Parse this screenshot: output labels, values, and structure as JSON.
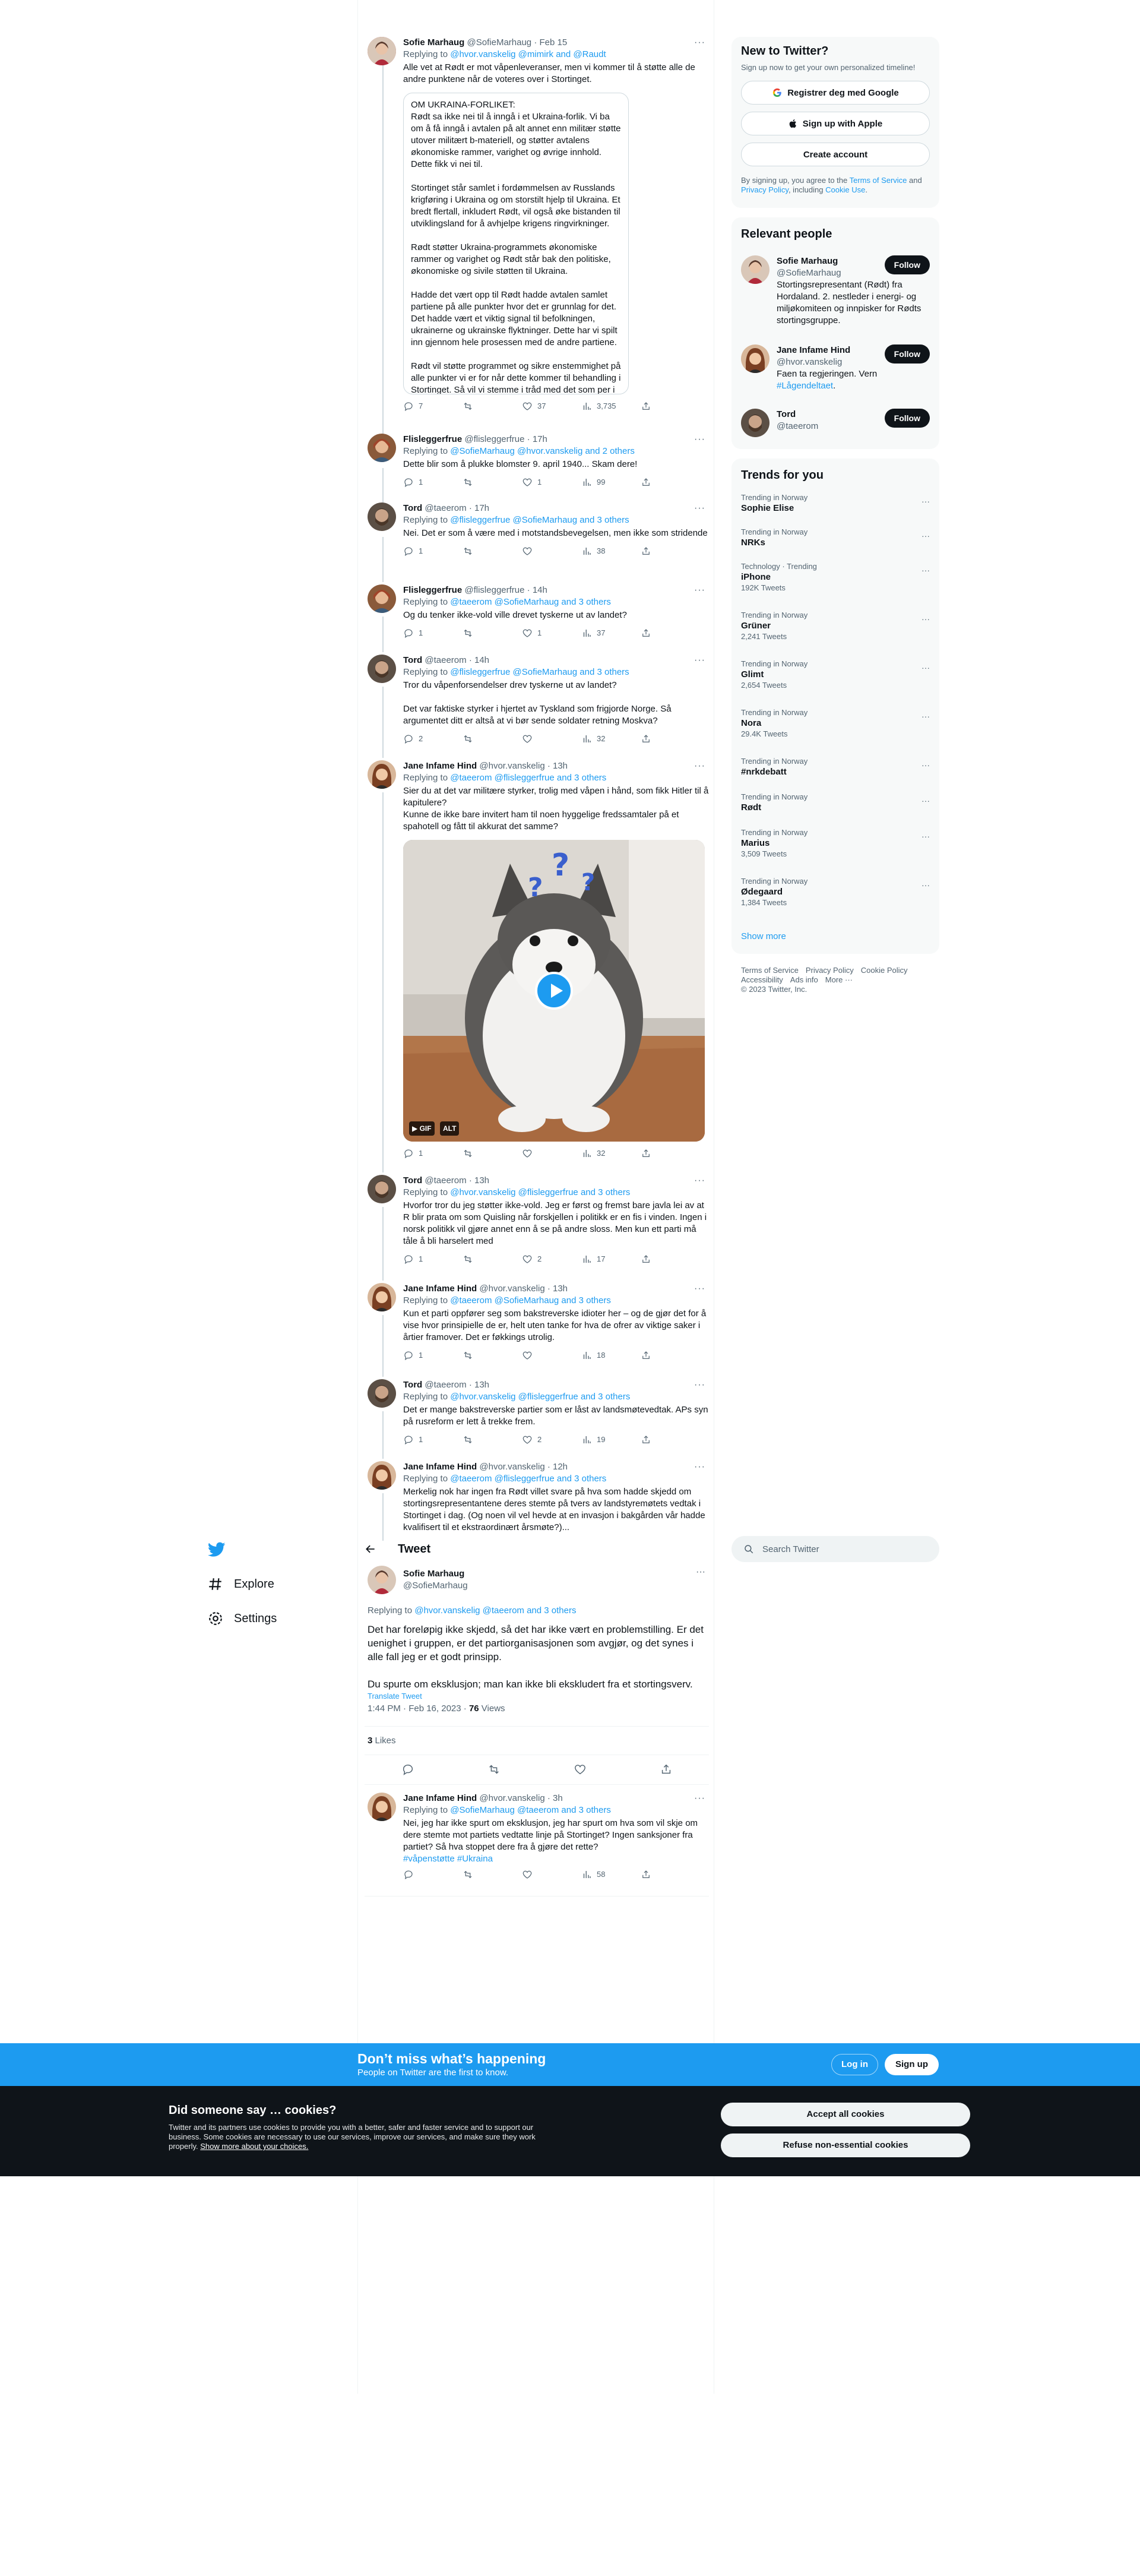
{
  "nav": {
    "explore": "Explore",
    "settings": "Settings"
  },
  "search": {
    "placeholder": "Search Twitter"
  },
  "signup": {
    "title": "New to Twitter?",
    "subtitle": "Sign up now to get your own personalized timeline!",
    "google": "Registrer deg med Google",
    "apple": "Sign up with Apple",
    "create": "Create account",
    "legal_pre": "By signing up, you agree to the ",
    "tos": "Terms of Service",
    "legal_mid": " and ",
    "privacy": "Privacy Policy",
    "legal_mid2": ", including ",
    "cookie": "Cookie Use",
    "legal_end": "."
  },
  "relevant": {
    "title": "Relevant people",
    "people": [
      {
        "name": "Sofie Marhaug",
        "handle": "@SofieMarhaug",
        "bio": "Stortingsrepresentant (Rødt) fra Hordaland. 2. nestleder i energi- og miljøkomiteen og innpisker for Rødts stortingsgruppe.",
        "follow": "Follow"
      },
      {
        "name": "Jane Infame Hind",
        "handle": "@hvor.vanskelig",
        "bio": "Faen ta regjeringen. Vern ",
        "bio_tag": "#Lågendeltaet",
        "bio_end": ".",
        "follow": "Follow"
      },
      {
        "name": "Tord",
        "handle": "@taeerom",
        "bio": "",
        "follow": "Follow"
      }
    ]
  },
  "trends": {
    "title": "Trends for you",
    "items": [
      {
        "meta": "Trending in Norway",
        "title": "Sophie Elise",
        "count": ""
      },
      {
        "meta": "Trending in Norway",
        "title": "NRKs",
        "count": ""
      },
      {
        "meta": "Technology · Trending",
        "title": "iPhone",
        "count": "192K Tweets"
      },
      {
        "meta": "Trending in Norway",
        "title": "Grüner",
        "count": "2,241 Tweets"
      },
      {
        "meta": "Trending in Norway",
        "title": "Glimt",
        "count": "2,654 Tweets"
      },
      {
        "meta": "Trending in Norway",
        "title": "Nora",
        "count": "29.4K Tweets"
      },
      {
        "meta": "Trending in Norway",
        "title": "#nrkdebatt",
        "count": ""
      },
      {
        "meta": "Trending in Norway",
        "title": "Rødt",
        "count": ""
      },
      {
        "meta": "Trending in Norway",
        "title": "Marius",
        "count": "3,509 Tweets"
      },
      {
        "meta": "Trending in Norway",
        "title": "Ødegaard",
        "count": "1,384 Tweets"
      }
    ],
    "show_more": "Show more"
  },
  "footer": {
    "links1": [
      "Terms of Service",
      "Privacy Policy",
      "Cookie Policy"
    ],
    "links2": [
      "Accessibility",
      "Ads info",
      "More ···"
    ],
    "copyright": "© 2023 Twitter, Inc."
  },
  "tweets": [
    {
      "name": "Sofie Marhaug",
      "handle": "@SofieMarhaug",
      "time": "Feb 15",
      "reply_pre": "Replying to ",
      "reply_to": "@hvor.vanskelig @mimirk and @Raudt",
      "text": "Alle vet at Rødt er mot våpenleveranser, men vi kommer til å støtte alle de andre punktene når de voteres over i Stortinget.",
      "quote": "OM UKRAINA-FORLIKET:\nRødt sa ikke nei til å inngå i et Ukraina-forlik. Vi ba om å få inngå i avtalen på alt annet enn militær støtte utover militært b-materiell, og støtter avtalens økonomiske rammer, varighet og øvrige innhold. Dette fikk vi nei til.\n\nStortinget står samlet i fordømmelsen av Russlands krigføring i Ukraina og om storstilt hjelp til Ukraina. Et bredt flertall, inkludert Rødt, vil også øke bistanden til utviklingsland for å avhjelpe krigens ringvirkninger.\n\nRødt støtter Ukraina-programmets økonomiske rammer og varighet og Rødt står bak den politiske, økonomiske og sivile støtten til Ukraina.\n\nHadde det vært opp til Rødt hadde avtalen samlet partiene på alle punkter hvor det er grunnlag for det. Det hadde vært et viktig signal til befolkningen, ukrainerne og ukrainske flyktninger. Dette har vi spilt inn gjennom hele prosessen med de andre partiene.\n\nRødt vil støtte programmet og sikre enstemmighet på alle punkter vi er for når dette kommer til behandling i Stortinget. Så vil vi stemme i tråd med det som per i dag er vedtatt politikk om ikke å stille oss bak militær",
      "replies": "7",
      "retweets": "",
      "likes": "37",
      "views": "3,735"
    },
    {
      "name": "Flisleggerfrue",
      "handle": "@flisleggerfrue",
      "time": "17h",
      "reply_pre": "Replying to ",
      "reply_to": "@SofieMarhaug @hvor.vanskelig and 2 others",
      "text": "Dette blir som å plukke blomster 9. april 1940... Skam dere!",
      "replies": "1",
      "retweets": "",
      "likes": "1",
      "views": "99"
    },
    {
      "name": "Tord",
      "handle": "@taeerom",
      "time": "17h",
      "reply_pre": "Replying to ",
      "reply_to": "@flisleggerfrue @SofieMarhaug and 3 others",
      "text": "Nei. Det er som å være med i motstandsbevegelsen, men ikke som stridende",
      "replies": "1",
      "retweets": "",
      "likes": "",
      "views": "38"
    },
    {
      "name": "Flisleggerfrue",
      "handle": "@flisleggerfrue",
      "time": "14h",
      "reply_pre": "Replying to ",
      "reply_to": "@taeerom @SofieMarhaug and 3 others",
      "text": "Og du tenker ikke-vold ville drevet tyskerne ut av landet?",
      "replies": "1",
      "retweets": "",
      "likes": "1",
      "views": "37"
    },
    {
      "name": "Tord",
      "handle": "@taeerom",
      "time": "14h",
      "reply_pre": "Replying to ",
      "reply_to": "@flisleggerfrue @SofieMarhaug and 3 others",
      "text": "Tror du våpenforsendelser drev tyskerne ut av landet?\n\nDet var faktiske styrker i hjertet av Tyskland som frigjorde Norge. Så argumentet ditt er altså at vi bør sende soldater retning Moskva?",
      "replies": "2",
      "retweets": "",
      "likes": "",
      "views": "32"
    },
    {
      "name": "Jane Infame Hind",
      "handle": "@hvor.vanskelig",
      "time": "13h",
      "reply_pre": "Replying to ",
      "reply_to": "@taeerom @flisleggerfrue and 3 others",
      "text": "Sier du at det var militære styrker, trolig med våpen i hånd, som fikk Hitler til å kapitulere?\nKunne de ikke bare invitert ham til noen hyggelige fredssamtaler på et spahotell og fått til akkurat det samme?",
      "media_badges": [
        "GIF",
        "ALT"
      ],
      "replies": "1",
      "retweets": "",
      "likes": "",
      "views": "32"
    },
    {
      "name": "Tord",
      "handle": "@taeerom",
      "time": "13h",
      "reply_pre": "Replying to ",
      "reply_to": "@hvor.vanskelig @flisleggerfrue and 3 others",
      "text": "Hvorfor tror du jeg støtter ikke-vold. Jeg er først og fremst bare javla lei av at R blir prata om som Quisling når forskjellen i politikk er en fis i vinden. Ingen i norsk politikk vil gjøre annet enn å se på andre sloss. Men kun ett parti må tåle å bli harselert med",
      "replies": "1",
      "retweets": "",
      "likes": "2",
      "views": "17"
    },
    {
      "name": "Jane Infame Hind",
      "handle": "@hvor.vanskelig",
      "time": "13h",
      "reply_pre": "Replying to ",
      "reply_to": "@taeerom @SofieMarhaug and 3 others",
      "text": "Kun et parti oppfører seg som bakstreverske idioter her – og de gjør det for å vise hvor prinsipielle de er, helt uten tanke for hva de ofrer av viktige saker i årtier framover. Det er føkkings utrolig.",
      "replies": "1",
      "retweets": "",
      "likes": "",
      "views": "18"
    },
    {
      "name": "Tord",
      "handle": "@taeerom",
      "time": "13h",
      "reply_pre": "Replying to ",
      "reply_to": "@hvor.vanskelig @flisleggerfrue and 3 others",
      "text": "Det er mange bakstreverske partier som er låst av landsmøtevedtak. APs syn på rusreform er lett å trekke frem.",
      "replies": "1",
      "retweets": "",
      "likes": "2",
      "views": "19"
    },
    {
      "name": "Jane Infame Hind",
      "handle": "@hvor.vanskelig",
      "time": "12h",
      "reply_pre": "Replying to ",
      "reply_to": "@taeerom @flisleggerfrue and 3 others",
      "text": "Merkelig nok har ingen fra Rødt villet svare på hva som hadde skjedd om stortingsrepresentantene deres stemte på tvers av landstyremøtets vedtak i Stortinget i dag. (Og noen vil vel hevde at en invasjon i bakgården vår hadde kvalifisert til et ekstraordinært årsmøte?)..."
    }
  ],
  "tweet_header": {
    "title": "Tweet"
  },
  "focal": {
    "name": "Sofie Marhaug",
    "handle": "@SofieMarhaug",
    "reply_pre": "Replying to ",
    "reply_to": "@hvor.vanskelig @taeerom and 3 others",
    "text1": "Det har foreløpig ikke skjedd, så det har ikke vært en problemstilling. Er det uenighet i gruppen, er det partiorganisasjonen som avgjør, og det synes i alle fall jeg er et godt prinsipp.",
    "text2": "Du spurte om eksklusjon; man kan ikke bli ekskludert fra et stortingsverv.",
    "translate": "Translate Tweet",
    "time": "1:44 PM · Feb 16, 2023 · ",
    "views": "76",
    "views_label": " Views",
    "likes": "3",
    "likes_label": " Likes"
  },
  "last_reply": {
    "name": "Jane Infame Hind",
    "handle": "@hvor.vanskelig",
    "time": "3h",
    "reply_pre": "Replying to ",
    "reply_to": "@SofieMarhaug @taeerom and 3 others",
    "text": "Nei, jeg har ikke spurt om eksklusjon, jeg har spurt om hva som vil skje om dere stemte mot partiets vedtatte linje på Stortinget? Ingen sanksjoner fra partiet? Så hva stoppet dere fra å gjøre det rette?",
    "tags": "#våpenstøtte #Ukraina",
    "replies": "",
    "retweets": "",
    "likes": "",
    "views": "58"
  },
  "banner": {
    "title": "Don’t miss what’s happening",
    "subtitle": "People on Twitter are the first to know.",
    "login": "Log in",
    "signup": "Sign up"
  },
  "cookies": {
    "title": "Did someone say … cookies?",
    "text": "Twitter and its partners use cookies to provide you with a better, safer and faster service and to support our business. Some cookies are necessary to use our services, improve our services, and make sure they work properly. ",
    "link": "Show more about your choices.",
    "accept": "Accept all cookies",
    "refuse": "Refuse non-essential cookies"
  },
  "colors": {
    "accent": "#1d9bf0",
    "text": "#0f1419",
    "muted": "#536471",
    "dark": "#0f1419"
  }
}
